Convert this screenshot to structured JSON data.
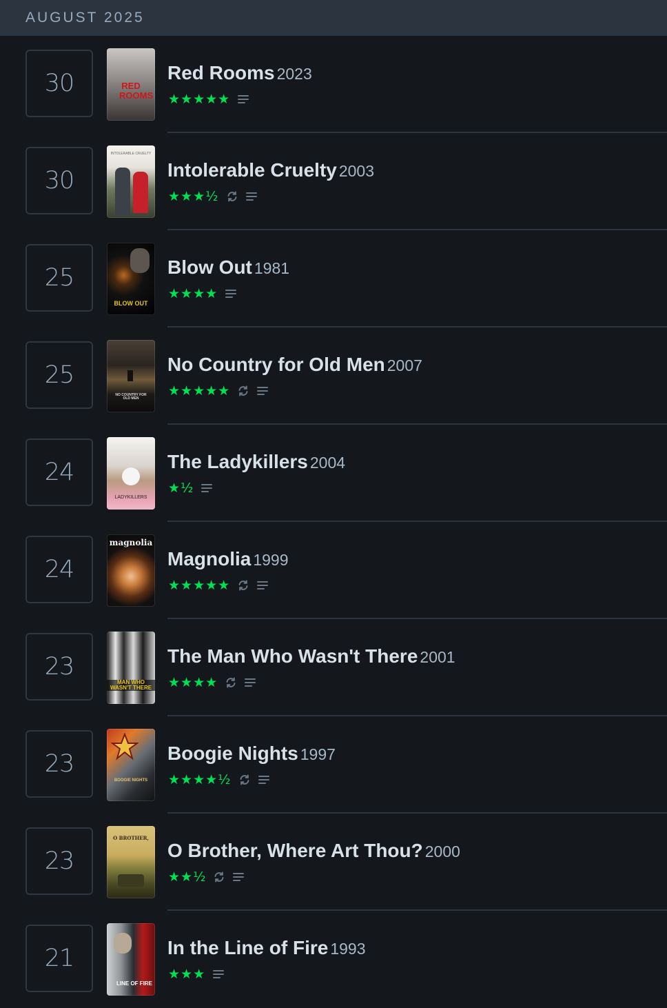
{
  "header": {
    "month_label": "AUGUST 2025"
  },
  "entries": [
    {
      "day": "30",
      "title": "Red Rooms",
      "year": "2023",
      "stars": "★★★★★",
      "rewatch": false,
      "poster_text": "RED ROOMS"
    },
    {
      "day": "30",
      "title": "Intolerable Cruelty",
      "year": "2003",
      "stars": "★★★½",
      "rewatch": true,
      "poster_text": "INTOLERABLE CRUELTY"
    },
    {
      "day": "25",
      "title": "Blow Out",
      "year": "1981",
      "stars": "★★★★",
      "rewatch": false,
      "poster_text": "BLOW OUT"
    },
    {
      "day": "25",
      "title": "No Country for Old Men",
      "year": "2007",
      "stars": "★★★★★",
      "rewatch": true,
      "poster_text": "NO COUNTRY FOR OLD MEN"
    },
    {
      "day": "24",
      "title": "The Ladykillers",
      "year": "2004",
      "stars": "★½",
      "rewatch": false,
      "poster_text": "LADYKILLERS"
    },
    {
      "day": "24",
      "title": "Magnolia",
      "year": "1999",
      "stars": "★★★★★",
      "rewatch": true,
      "poster_text": "magnolia"
    },
    {
      "day": "23",
      "title": "The Man Who Wasn't There",
      "year": "2001",
      "stars": "★★★★",
      "rewatch": true,
      "poster_text": "MAN WHO WASN'T THERE"
    },
    {
      "day": "23",
      "title": "Boogie Nights",
      "year": "1997",
      "stars": "★★★★½",
      "rewatch": true,
      "poster_text": "BOOGIE NIGHTS"
    },
    {
      "day": "23",
      "title": "O Brother, Where Art Thou?",
      "year": "2000",
      "stars": "★★½",
      "rewatch": true,
      "poster_text": "O BROTHER,"
    },
    {
      "day": "21",
      "title": "In the Line of Fire",
      "year": "1993",
      "stars": "★★★",
      "rewatch": false,
      "poster_text": "LINE OF FIRE"
    }
  ],
  "colors": {
    "background": "#14181c",
    "header_bg": "#2c3440",
    "star_green": "#00e054",
    "title": "#d8e0e8",
    "muted": "#9ab"
  }
}
